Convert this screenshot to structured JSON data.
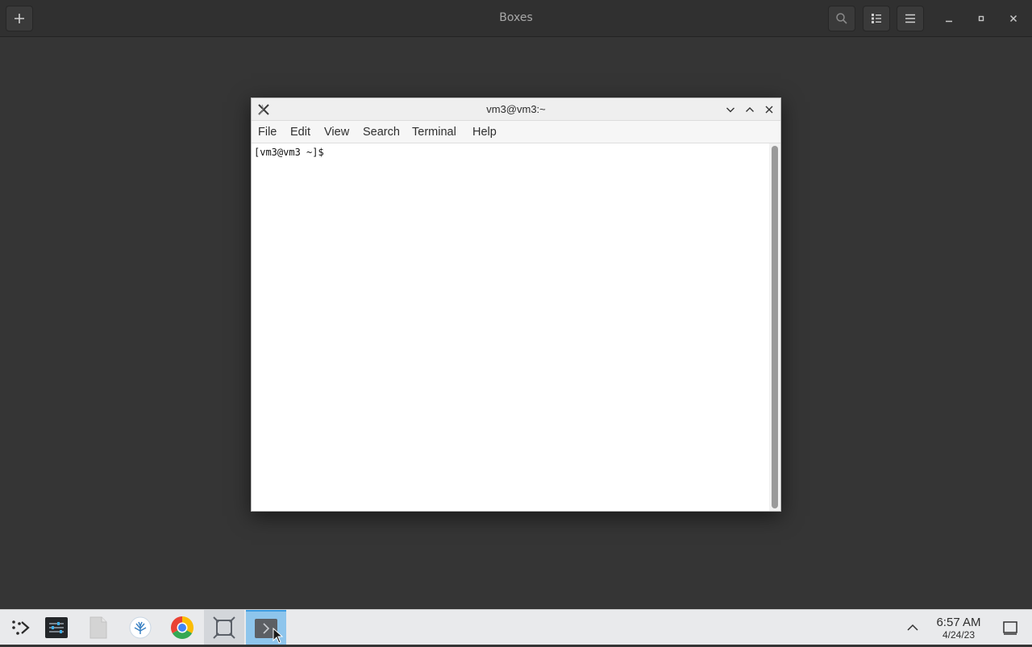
{
  "boxes": {
    "title": "Boxes",
    "new_button": "add-icon",
    "search_button": "search-icon",
    "view_button": "list-view-icon",
    "menu_button": "hamburger-menu-icon"
  },
  "terminal": {
    "title": "vm3@vm3:~",
    "menu": [
      "File",
      "Edit",
      "View",
      "Search",
      "Terminal",
      "Help"
    ],
    "prompt": "[vm3@vm3 ~]$"
  },
  "taskbar": {
    "apps": [
      "application-launcher-icon",
      "system-settings-icon",
      "files-icon",
      "discover-icon",
      "chrome-icon",
      "boxes-icon",
      "terminal-icon"
    ],
    "clock": {
      "time": "6:57 AM",
      "date": "4/24/23"
    }
  },
  "colors": {
    "desktop_bg": "#353535",
    "header_bg": "#303030",
    "taskbar_bg": "#e9eaec",
    "active_task": "#8ec5ec"
  }
}
